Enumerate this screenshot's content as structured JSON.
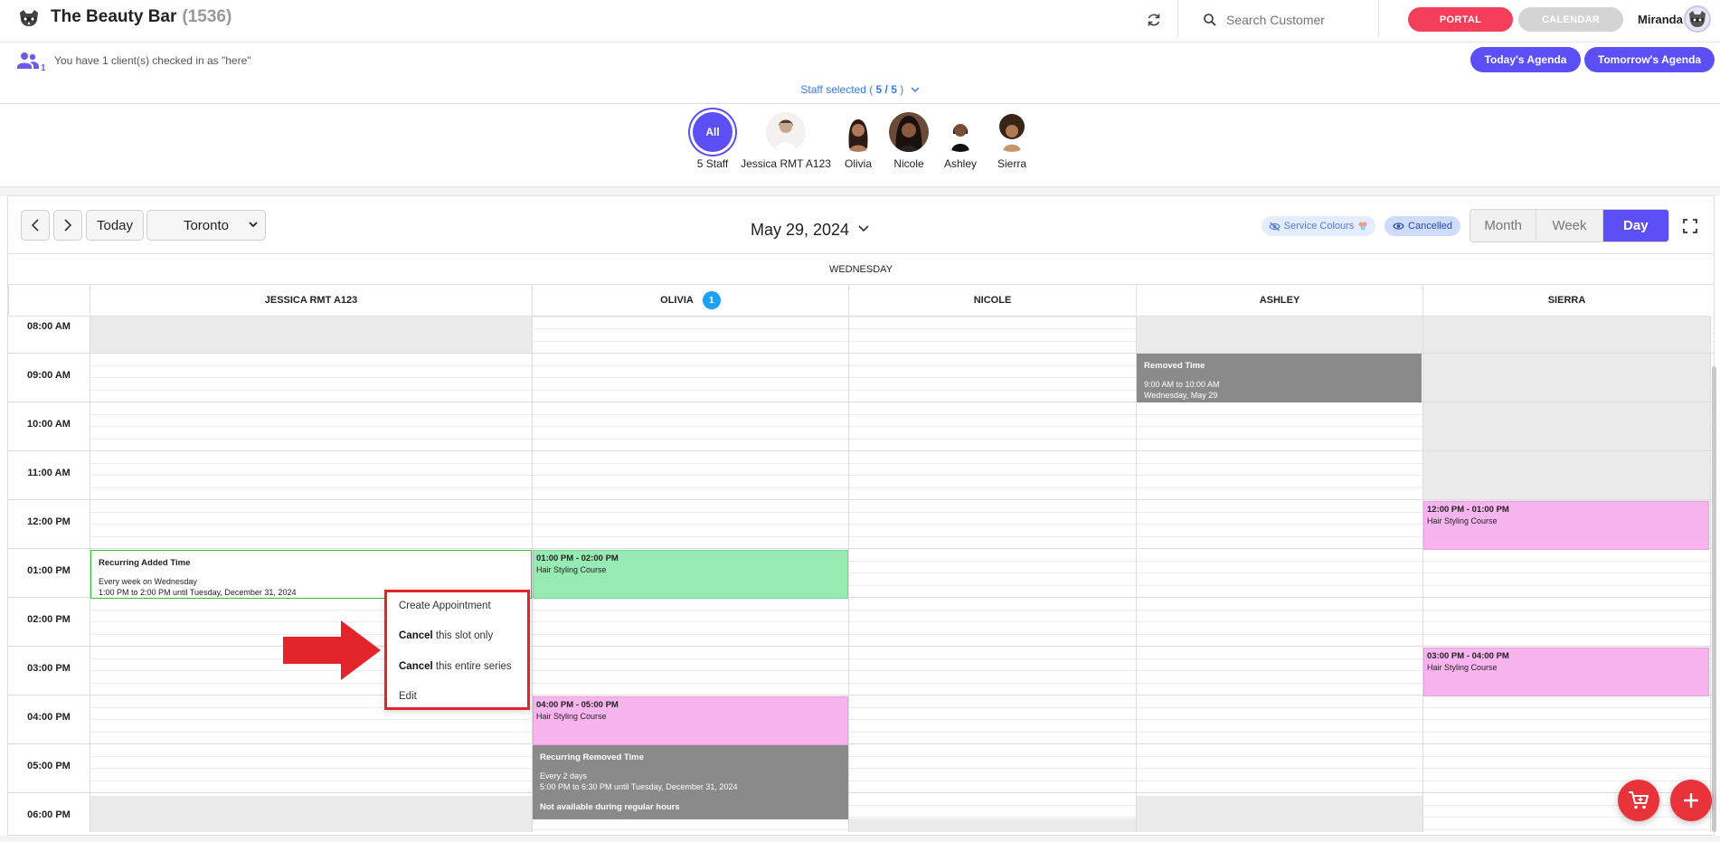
{
  "header": {
    "brand": "The Beauty Bar",
    "brand_count": "(1536)",
    "search_placeholder": "Search Customer",
    "portal_label": "PORTAL",
    "calendar_label": "CALENDAR",
    "user_name": "Miranda",
    "icons": [
      "raccoon-logo-icon",
      "refresh-icon",
      "search-icon",
      "avatar"
    ]
  },
  "checkin": {
    "count": "1",
    "text": "You have 1 client(s) checked in as \"here\"",
    "today_agenda": "Today's Agenda",
    "tomorrow_agenda": "Tomorrow's Agenda"
  },
  "staff_selected": {
    "prefix": "Staff selected ( ",
    "value": "5 / 5",
    "suffix": " )"
  },
  "staff": [
    {
      "name": "5 Staff",
      "avatar_text": "All"
    },
    {
      "name": "Jessica RMT A123"
    },
    {
      "name": "Olivia"
    },
    {
      "name": "Nicole"
    },
    {
      "name": "Ashley"
    },
    {
      "name": "Sierra"
    }
  ],
  "toolbar": {
    "today": "Today",
    "timezone": "Toronto",
    "date": "May 29, 2024",
    "service_colours": "Service Colours",
    "cancelled": "Cancelled",
    "views": [
      "Month",
      "Week",
      "Day"
    ],
    "active_view": "Day"
  },
  "grid": {
    "day": "WEDNESDAY",
    "columns": [
      {
        "name": "JESSICA RMT A123"
      },
      {
        "name": "OLIVIA",
        "badge": "1"
      },
      {
        "name": "NICOLE"
      },
      {
        "name": "ASHLEY"
      },
      {
        "name": "SIERRA"
      }
    ],
    "times": [
      "08:00 AM",
      "09:00 AM",
      "10:00 AM",
      "11:00 AM",
      "12:00 PM",
      "01:00 PM",
      "02:00 PM",
      "03:00 PM",
      "04:00 PM",
      "05:00 PM",
      "06:00 PM"
    ]
  },
  "events": {
    "ashley_removed": {
      "title": "Removed Time",
      "line1": "9:00 AM to 10:00 AM",
      "line2": "Wednesday, May 29"
    },
    "sierra_1": {
      "time": "12:00 PM - 01:00 PM",
      "name": "Hair Styling Course"
    },
    "jessica_recurring": {
      "title": "Recurring Added Time",
      "line1": "Every week on Wednesday",
      "line2": "1:00 PM to 2:00 PM until Tuesday, December 31, 2024"
    },
    "olivia_1": {
      "time": "01:00 PM - 02:00 PM",
      "name": "Hair Styling Course"
    },
    "sierra_2": {
      "time": "03:00 PM - 04:00 PM",
      "name": "Hair Styling Course"
    },
    "olivia_2": {
      "time": "04:00 PM - 05:00 PM",
      "name": "Hair Styling Course"
    },
    "olivia_removed": {
      "title": "Recurring Removed Time",
      "line1": "Every 2 days",
      "line2": "5:00 PM to 6:30 PM until Tuesday, December 31, 2024",
      "line3": "Not available during regular hours"
    }
  },
  "context_menu": {
    "create": "Create Appointment",
    "cancel_slot_bold": "Cancel",
    "cancel_slot_rest": " this slot only",
    "cancel_series_bold": "Cancel",
    "cancel_series_rest": " this entire series",
    "edit": "Edit"
  },
  "colors": {
    "accent": "#5b4ff5",
    "portal": "#f43e5a",
    "green_event": "#98eab3",
    "pink_event": "#f8b4ee",
    "removed_time": "#8a8a8a",
    "highlight": "#e3242b"
  },
  "fabs": [
    "add-to-cart-icon",
    "plus-icon"
  ]
}
